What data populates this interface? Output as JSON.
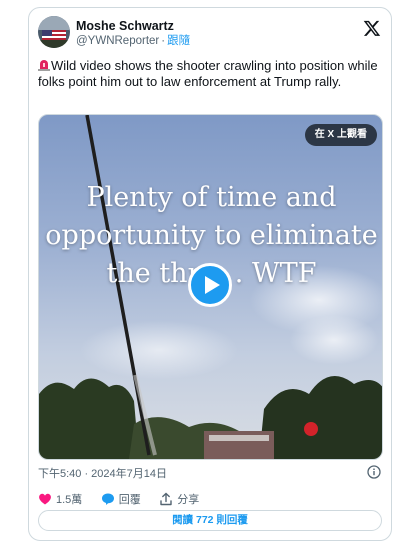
{
  "author": {
    "display_name": "Moshe Schwartz",
    "handle": "@YWNReporter",
    "separator": "·",
    "follow_label": "跟隨"
  },
  "tweet": {
    "text": "Wild video shows the shooter crawling into position while folks point him out to law enforcement at Trump rally."
  },
  "media": {
    "caption_lines": [
      "Plenty of time and",
      "opportunity to eliminate",
      "the thr    . WTF"
    ],
    "view_on_x_label": "在 X 上觀看"
  },
  "meta": {
    "timestamp": "下午5:40 · 2024年7月14日"
  },
  "actions": {
    "likes": "1.5萬",
    "reply_label": "回覆",
    "share_label": "分享"
  },
  "read_replies_label": "閱讀 772 則回覆",
  "colors": {
    "accent": "#1d9bf0",
    "like": "#f91880",
    "text_secondary": "#536471",
    "border": "#cfd9de"
  },
  "icons": [
    "x-logo-icon",
    "siren-icon",
    "play-icon",
    "info-icon",
    "heart-icon",
    "reply-bubble-icon",
    "share-icon"
  ]
}
